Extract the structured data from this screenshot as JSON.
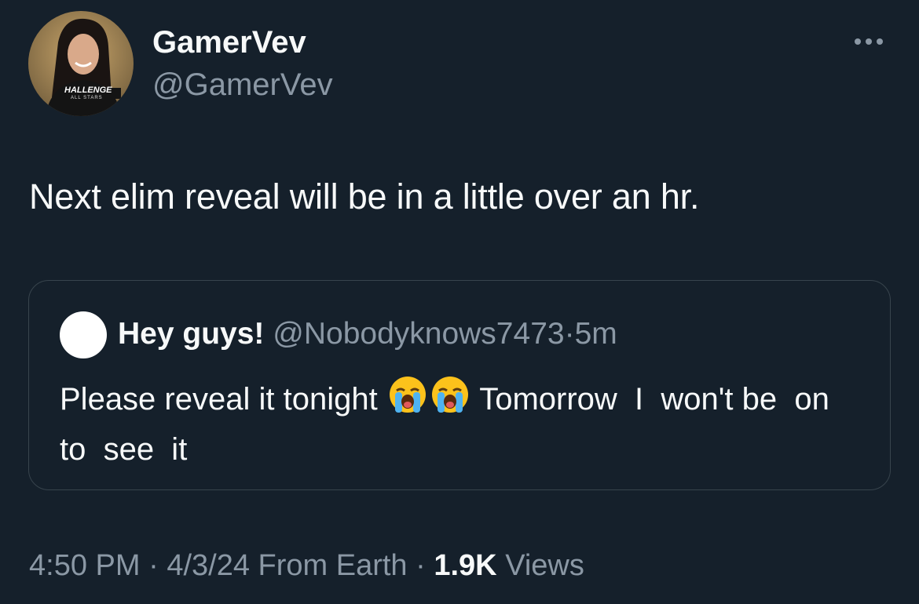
{
  "author": {
    "display_name": "GamerVev",
    "handle": "@GamerVev",
    "avatar_logo_text": "HALLENGE",
    "avatar_logo_subtext": "ALL STARS"
  },
  "more_icon": "more-horizontal-icon",
  "tweet": {
    "text": "Next elim reveal will be in a little over an hr."
  },
  "quote": {
    "name": "Hey guys!",
    "handle": "@Nobodyknows7473",
    "separator": "·",
    "time": "5m",
    "text_part1": "Please reveal it tonight ",
    "emoji_name": "loudly-crying-face-icon",
    "text_part2": " Tomorrow  I  won't be  on   to  see  it"
  },
  "meta": {
    "time": "4:50 PM",
    "sep1": " · ",
    "date": "4/3/24",
    "source": " From Earth",
    "sep2": " · ",
    "views_count": "1.9K",
    "views_label": " Views"
  },
  "colors": {
    "background": "#15202b",
    "primary_text": "#f7f9f9",
    "secondary_text": "#8b98a5",
    "border": "#38444d"
  }
}
